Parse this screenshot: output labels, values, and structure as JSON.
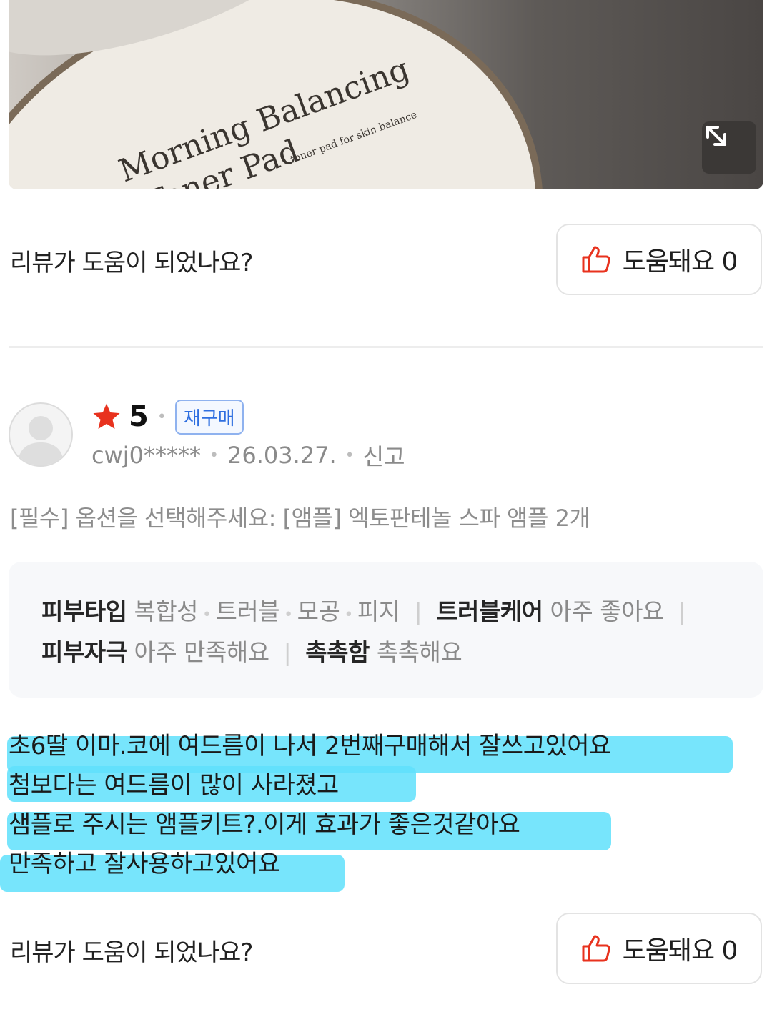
{
  "photo": {
    "product_text_line1": "Morning Balancing",
    "product_text_line2": "Toner Pad",
    "product_subtext": "toner pad for skin balance",
    "expand_icon": "expand-arrows-icon"
  },
  "helpful_top": {
    "question": "리뷰가 도움이 되었나요?",
    "button_label": "도움돼요 0",
    "icon": "thumbs-up-icon"
  },
  "review": {
    "rating": "5",
    "rebuy_badge": "재구매",
    "user": "cwj0*****",
    "date": "26.03.27.",
    "report": "신고",
    "option": "[필수] 옵션을 선택해주세요: [앰플] 엑토판테놀 스파 앰플 2개",
    "attrs": {
      "skin_type_key": "피부타입",
      "skin_type_vals": [
        "복합성",
        "트러블",
        "모공",
        "피지"
      ],
      "trouble_care_key": "트러블케어",
      "trouble_care_val": "아주 좋아요",
      "irritation_key": "피부자극",
      "irritation_val": "아주 만족해요",
      "moist_key": "촉촉함",
      "moist_val": "촉촉해요"
    },
    "body_lines": [
      "초6딸 이마.코에 여드름이 나서 2번째구매해서 잘쓰고있어요",
      "첨보다는 여드름이 많이 사라졌고",
      "샘플로 주시는 앰플키트?.이게  효과가 좋은것같아요",
      "만족하고 잘사용하고있어요"
    ]
  },
  "helpful_bottom": {
    "question": "리뷰가 도움이 되었나요?",
    "button_label": "도움돼요 0"
  },
  "colors": {
    "star": "#e8321e",
    "thumb": "#e8321e",
    "rebuy": "#2f6fe0",
    "highlight": "#5fe0fb"
  }
}
